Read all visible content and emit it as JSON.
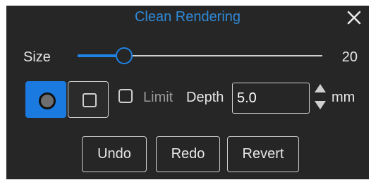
{
  "window": {
    "title": "Clean Rendering",
    "close_icon": "close-icon"
  },
  "size": {
    "label": "Size",
    "value": "20",
    "slider_fraction": 0.19
  },
  "brush_shape": {
    "options": [
      {
        "name": "circle",
        "icon": "circle-brush-icon",
        "selected": true
      },
      {
        "name": "square",
        "icon": "square-brush-icon",
        "selected": false
      }
    ]
  },
  "limit": {
    "label": "Limit",
    "checked": false
  },
  "depth": {
    "label": "Depth",
    "value": "5.0",
    "unit": "mm"
  },
  "buttons": {
    "undo": "Undo",
    "redo": "Redo",
    "revert": "Revert"
  },
  "colors": {
    "accent": "#1f83e6",
    "title": "#2f8ad8",
    "panel_bg": "#262626",
    "disabled_text": "#9a9a9a"
  }
}
